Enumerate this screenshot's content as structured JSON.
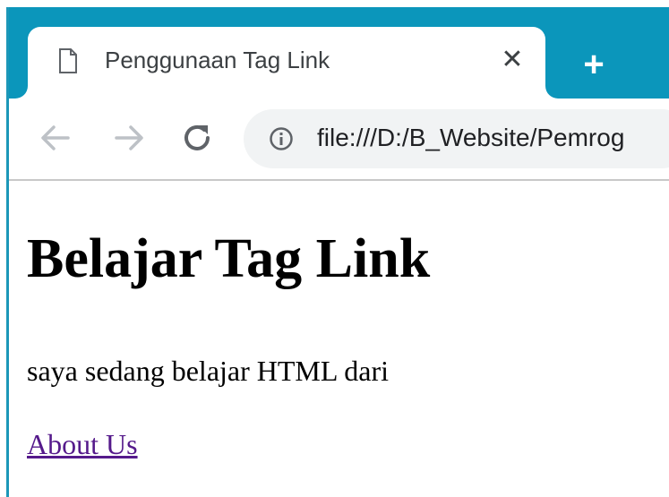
{
  "browser": {
    "tab": {
      "title": "Penggunaan Tag Link",
      "icon": "page-icon",
      "close_symbol": "✕"
    },
    "new_tab_symbol": "+",
    "url": "file:///D:/B_Website/Pemrog",
    "accent_color": "#0b96bb"
  },
  "page": {
    "heading": "Belajar Tag Link",
    "paragraph": "saya sedang belajar HTML dari",
    "link_text": "About Us",
    "link_color": "#551a8b"
  }
}
